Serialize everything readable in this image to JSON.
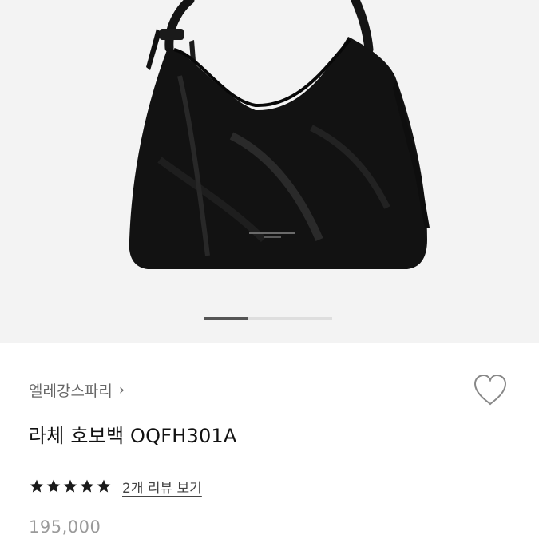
{
  "gallery": {
    "image_alt": "라체 호보백 OQFH301A",
    "current_slide_fraction": 0.34
  },
  "product": {
    "brand": "엘레강스파리",
    "title": "라체 호보백 OQFH301A",
    "rating_stars": 5,
    "review_link": "2개 리뷰 보기",
    "price": "195,000"
  },
  "colors": {
    "pager_active": "#555555",
    "pager_track": "#dedede",
    "star": "#1a1a1a"
  }
}
